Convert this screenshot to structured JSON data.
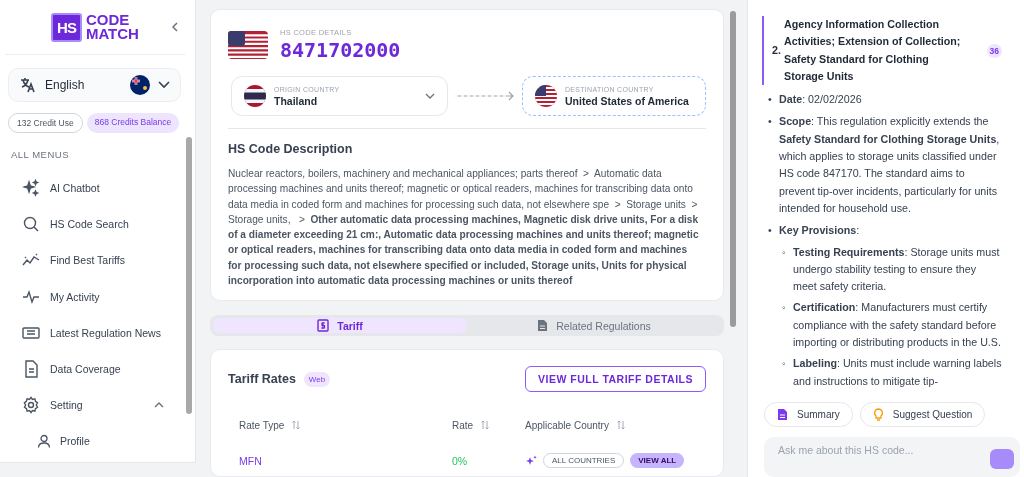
{
  "sidebar": {
    "logo": {
      "mark": "HS",
      "lines": [
        "CODE",
        "MATCH"
      ]
    },
    "language": {
      "label": "English"
    },
    "credits": [
      {
        "label": "132 Credit Use",
        "kind": "outline"
      },
      {
        "label": "868 Credits Balance",
        "kind": "filled"
      }
    ],
    "menu_heading": "ALL MENUS",
    "items": [
      {
        "label": "AI Chatbot",
        "kind": "sparkle"
      },
      {
        "label": "HS Code Search",
        "kind": "search"
      },
      {
        "label": "Find Best Tariffs",
        "kind": "trend"
      },
      {
        "label": "My Activity",
        "kind": "activity"
      },
      {
        "label": "Latest Regulation News",
        "kind": "news"
      },
      {
        "label": "Data Coverage",
        "kind": "doc"
      },
      {
        "label": "Setting",
        "kind": "gear",
        "expanded": true,
        "children": [
          {
            "label": "Profile",
            "kind": "user"
          }
        ]
      }
    ]
  },
  "hs_code": {
    "heading": "HS CODE DETAILS",
    "code": "8471702000",
    "origin": {
      "label": "ORIGIN COUNTRY",
      "value": "Thailand"
    },
    "destination": {
      "label": "DESTINATION COUNTRY",
      "value": "United States of America"
    },
    "description_title": "HS Code Description",
    "description": "Nuclear reactors, boilers, machinery and mechanical appliances; parts thereof  >  Automatic data processing machines and units thereof; magnetic or optical readers, machines for transcribing data onto data media in coded form and machines for processing such data, not elsewhere spe  >  Storage units  >  Storage units,   >  **Other automatic data processing machines, Magnetic disk drive units, For a disk of a diameter exceeding 21 cm:, Automatic data processing machines and units thereof; magnetic or optical readers, machines for transcribing data onto data media in coded form and machines for processing such data, not elsewhere specified or included, Storage units, Units for physical incorporation into automatic data processing machines or units thereof**"
  },
  "tabs": [
    {
      "label": "Tariff",
      "kind": "dollar",
      "selected": true
    },
    {
      "label": "Related Regulations",
      "kind": "doc",
      "selected": false
    }
  ],
  "tariff": {
    "title": "Tariff Rates",
    "badge": "Web",
    "button": "VIEW FULL TARIFF DETAILS",
    "columns": [
      "Rate Type",
      "Rate",
      "Applicable Country"
    ],
    "rows": [
      {
        "rate_type": "MFN",
        "rate": "0%",
        "country": "ALL COUNTRIES",
        "action": "VIEW ALL"
      }
    ]
  },
  "regulation": {
    "number": "2.",
    "title": "Agency Information Collection Activities; Extension of Collection; Safety Standard for Clothing Storage Units",
    "badge": "36",
    "bullets": [
      {
        "marker": "•",
        "text": "**Date**: 02/02/2026"
      },
      {
        "marker": "•",
        "text": "**Scope**: This regulation explicitly extends the **Safety Standard for Clothing Storage Units**, which applies to storage units classified under HS code 847170. The standard aims to prevent tip-over incidents, particularly for units intended for household use."
      },
      {
        "marker": "•",
        "text": "**Key Provisions**:",
        "children": [
          {
            "marker": "◦",
            "text": "**Testing Requirements**: Storage units must undergo stability testing to ensure they meet safety criteria."
          },
          {
            "marker": "◦",
            "text": "**Certification**: Manufacturers must certify compliance with the safety standard before importing or distributing products in the U.S."
          },
          {
            "marker": "◦",
            "text": "**Labeling**: Units must include warning labels and instructions to mitigate tip-"
          }
        ]
      }
    ]
  },
  "actions": [
    {
      "label": "Summary",
      "kind": "summary"
    },
    {
      "label": "Suggest Question",
      "kind": "bulb"
    }
  ],
  "chat_input": {
    "placeholder": "Ask me about this HS code..."
  }
}
